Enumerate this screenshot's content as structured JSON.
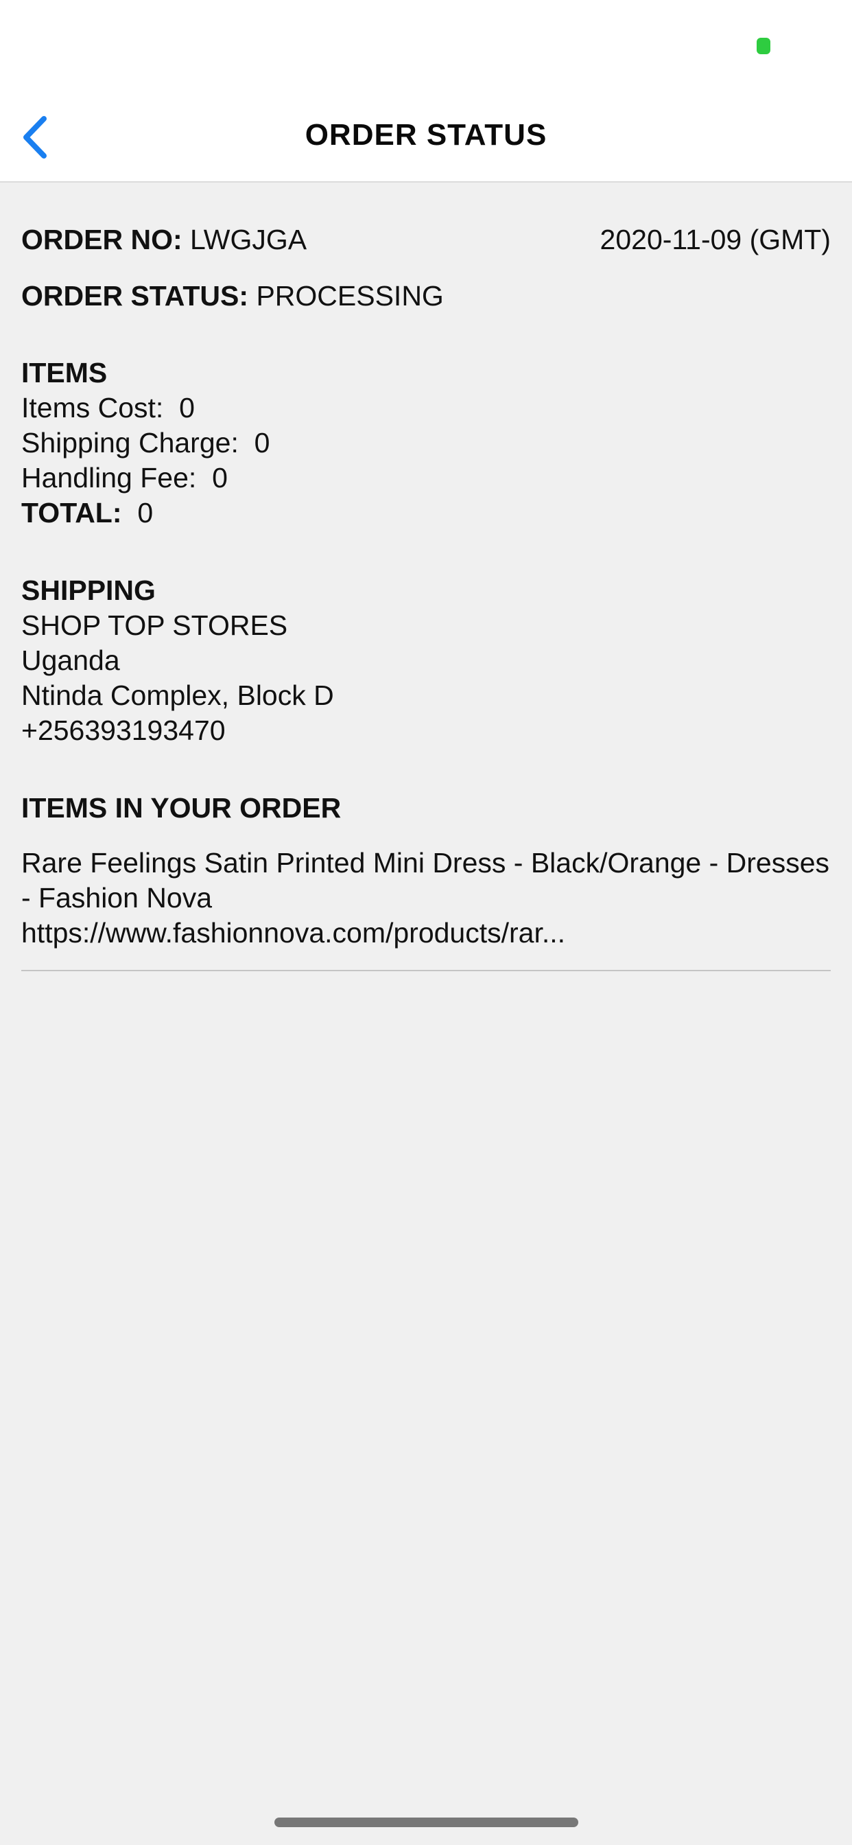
{
  "nav": {
    "title": "ORDER STATUS",
    "back_icon": "chevron-left-icon",
    "accent_color": "#1a7ff0"
  },
  "status_bar": {
    "indicator_color": "#2ecc40"
  },
  "order": {
    "number_label": "ORDER NO:",
    "number_value": "LWGJGA",
    "date": "2020-11-09 (GMT)",
    "status_label": "ORDER STATUS:",
    "status_value": "PROCESSING"
  },
  "items": {
    "heading": "ITEMS",
    "cost_label": "Items Cost:",
    "cost_value": "0",
    "shipping_label": "Shipping Charge:",
    "shipping_value": "0",
    "handling_label": "Handling Fee:",
    "handling_value": "0",
    "total_label": "TOTAL:",
    "total_value": "0"
  },
  "shipping": {
    "heading": "SHIPPING",
    "lines": [
      "SHOP TOP STORES",
      "Uganda",
      "Ntinda Complex, Block D",
      "+256393193470"
    ]
  },
  "order_items": {
    "heading": "ITEMS IN YOUR ORDER",
    "list": [
      {
        "title": "Rare Feelings Satin Printed Mini Dress - Black/Orange - Dresses - Fashion Nova",
        "url": "https://www.fashionnova.com/products/rar..."
      }
    ]
  }
}
